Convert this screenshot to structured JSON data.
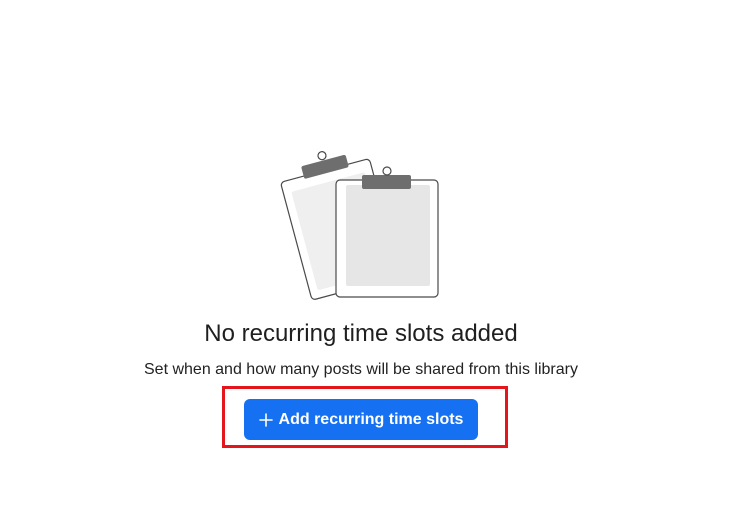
{
  "empty_state": {
    "illustration_icon": "clipboards-icon",
    "title": "No recurring time slots added",
    "subtitle": "Set when and how many posts will be shared from this library",
    "add_button_label": "Add recurring time slots",
    "add_button_icon": "plus-icon"
  },
  "colors": {
    "primary": "#1571f2",
    "highlight": "#e5161b"
  }
}
